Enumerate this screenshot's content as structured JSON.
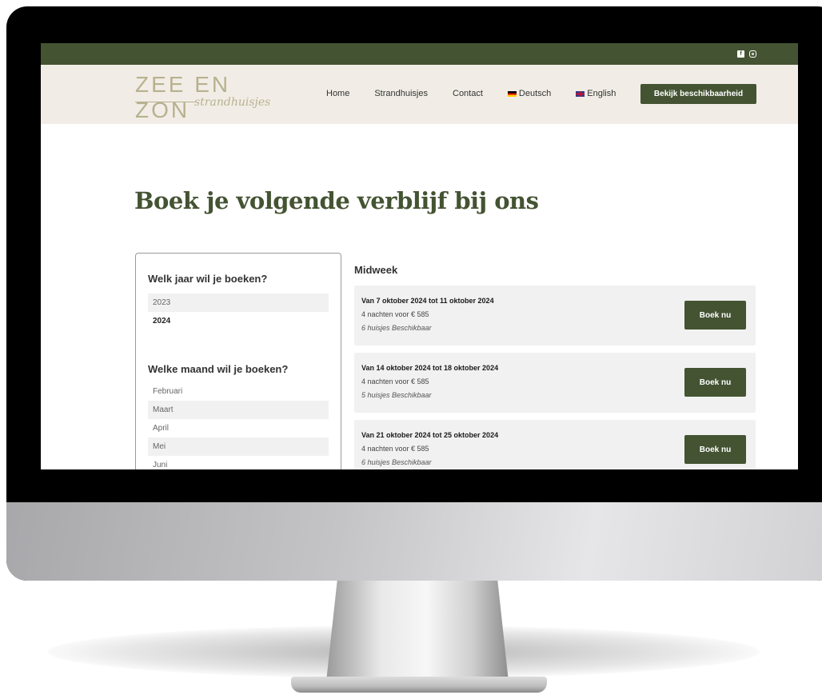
{
  "header": {
    "logo_main": "ZEE EN ZON",
    "logo_sub": "strandhuisjes",
    "nav": [
      {
        "label": "Home"
      },
      {
        "label": "Strandhuisjes"
      },
      {
        "label": "Contact"
      },
      {
        "label": "Deutsch",
        "flag": "germany-flag-icon"
      },
      {
        "label": "English",
        "flag": "uk-flag-icon"
      }
    ],
    "cta_label": "Bekijk beschikbaarheid",
    "social_icons": [
      "facebook-icon",
      "instagram-icon"
    ]
  },
  "page": {
    "title": "Boek je volgende verblijf bij ons"
  },
  "sidebar": {
    "year_heading": "Welk jaar wil je boeken?",
    "years": [
      "2023",
      "2024"
    ],
    "selected_year": "2024",
    "month_heading": "Welke maand wil je boeken?",
    "months": [
      "Februari",
      "Maart",
      "April",
      "Mei",
      "Juni"
    ]
  },
  "main": {
    "section_title": "Midweek",
    "offers": [
      {
        "title": "Van 7 oktober 2024 tot 11 oktober 2024",
        "price": "4 nachten voor € 585",
        "availability": "6 huisjes Beschikbaar",
        "button": "Boek nu"
      },
      {
        "title": "Van 14 oktober 2024 tot 18 oktober 2024",
        "price": "4 nachten voor € 585",
        "availability": "5 huisjes Beschikbaar",
        "button": "Boek nu"
      },
      {
        "title": "Van 21 oktober 2024 tot 25 oktober 2024",
        "price": "4 nachten voor € 585",
        "availability": "6 huisjes Beschikbaar",
        "button": "Boek nu"
      }
    ]
  },
  "colors": {
    "brand_green": "#445332",
    "header_bg": "#f1ede6",
    "logo_color": "#b8b18f",
    "card_bg": "#f1f1f1"
  }
}
